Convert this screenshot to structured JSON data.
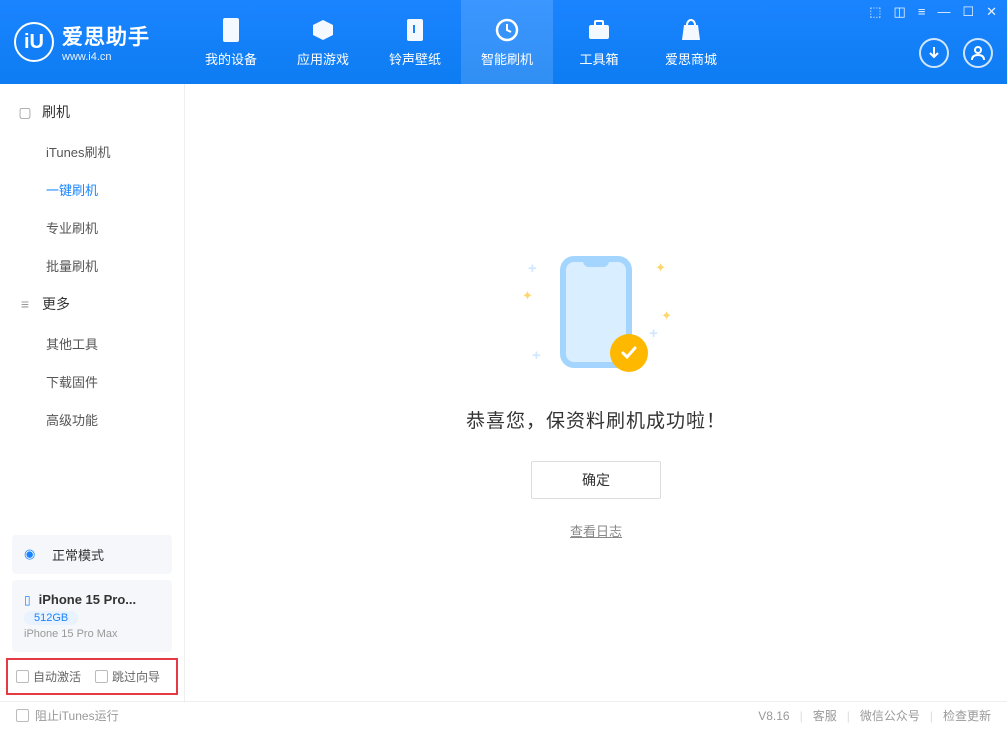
{
  "app": {
    "name": "爱思助手",
    "url": "www.i4.cn"
  },
  "nav": {
    "items": [
      {
        "label": "我的设备"
      },
      {
        "label": "应用游戏"
      },
      {
        "label": "铃声壁纸"
      },
      {
        "label": "智能刷机"
      },
      {
        "label": "工具箱"
      },
      {
        "label": "爱思商城"
      }
    ]
  },
  "sidebar": {
    "group1": {
      "title": "刷机",
      "items": [
        "iTunes刷机",
        "一键刷机",
        "专业刷机",
        "批量刷机"
      ]
    },
    "group2": {
      "title": "更多",
      "items": [
        "其他工具",
        "下载固件",
        "高级功能"
      ]
    },
    "status_label": "正常模式",
    "device": {
      "name": "iPhone 15 Pro...",
      "storage": "512GB",
      "model": "iPhone 15 Pro Max"
    },
    "checks": {
      "auto_activate": "自动激活",
      "skip_guide": "跳过向导"
    }
  },
  "main": {
    "message": "恭喜您，保资料刷机成功啦！",
    "ok_btn": "确定",
    "log_link": "查看日志"
  },
  "footer": {
    "block_itunes": "阻止iTunes运行",
    "version": "V8.16",
    "support": "客服",
    "wechat": "微信公众号",
    "check_update": "检查更新"
  }
}
